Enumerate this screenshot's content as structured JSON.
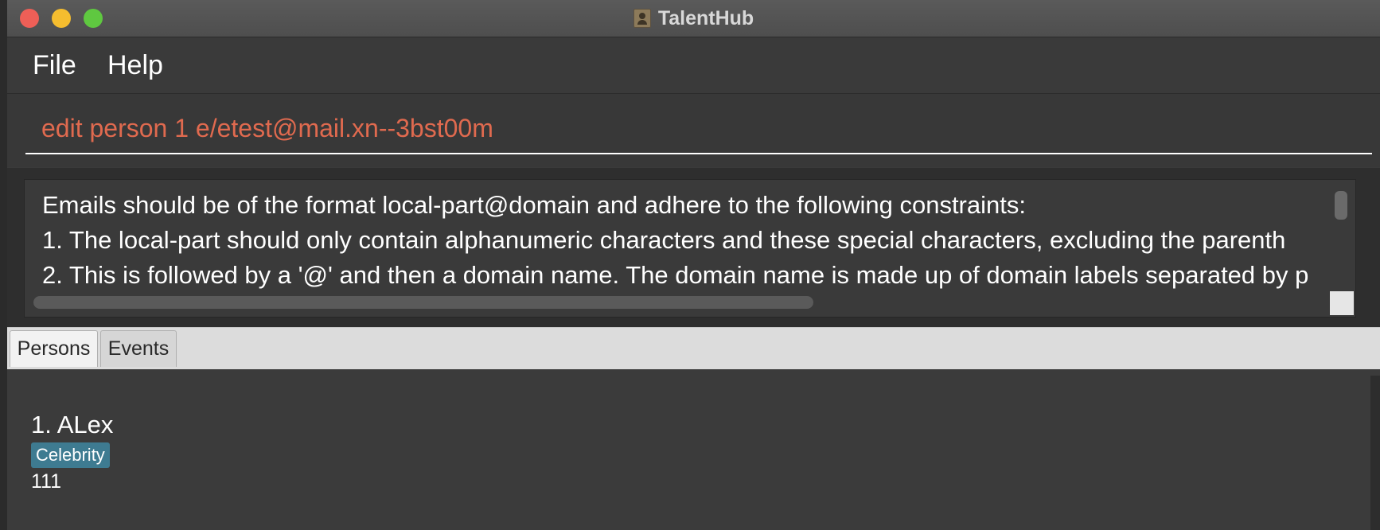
{
  "window": {
    "title": "TalentHub"
  },
  "menu": {
    "file": "File",
    "help": "Help"
  },
  "command": {
    "value": "edit person 1 e/etest@mail.xn--3bst00m"
  },
  "result": {
    "lines": [
      "Emails should be of the format local-part@domain and adhere to the following constraints:",
      "1. The local-part should only contain alphanumeric characters and these special characters, excluding the parenth",
      "2. This is followed by a '@' and then a domain name. The domain name is made up of domain labels separated by p"
    ]
  },
  "tabs": [
    {
      "label": "Persons",
      "active": true
    },
    {
      "label": "Events",
      "active": false
    }
  ],
  "persons": [
    {
      "name": "1. ALex",
      "tag": "Celebrity",
      "phone": "111"
    }
  ],
  "colors": {
    "command_text": "#e06a4f",
    "tag_background": "#3e7b91",
    "close": "#ee5f57",
    "minimize": "#f5bd2f",
    "maximize": "#5fc840"
  }
}
